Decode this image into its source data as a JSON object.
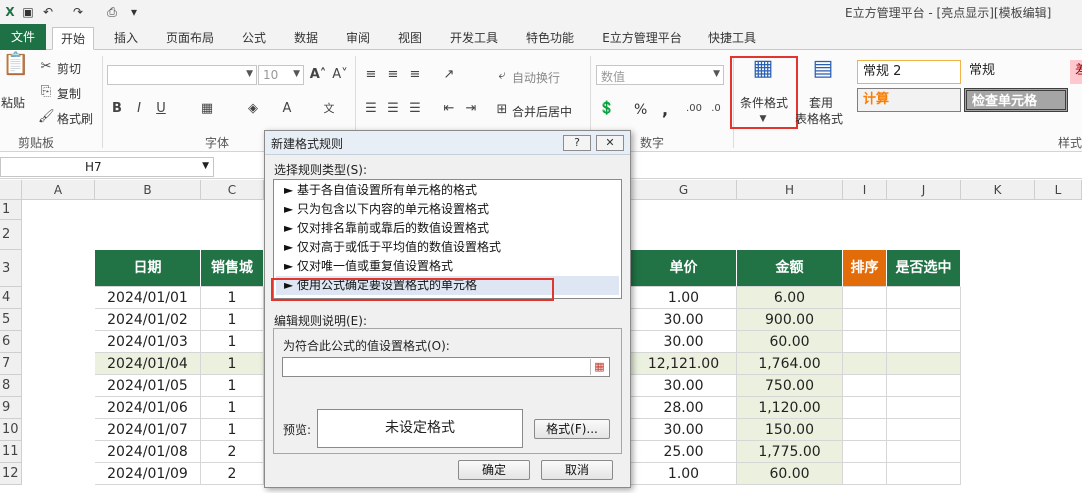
{
  "title_bar": {
    "text": "E立方管理平台 - [亮点显示][模板编辑]"
  },
  "tabs": [
    "文件",
    "开始",
    "插入",
    "页面布局",
    "公式",
    "数据",
    "审阅",
    "视图",
    "开发工具",
    "特色功能",
    "E立方管理平台",
    "快捷工具"
  ],
  "ribbon": {
    "clipboard": {
      "paste": "粘贴",
      "cut": "剪切",
      "copy": "复制",
      "format_painter": "格式刷",
      "label": "剪贴板"
    },
    "font": {
      "size": "10",
      "label": "字体"
    },
    "alignment": {
      "wrap": "自动换行",
      "merge": "合并后居中"
    },
    "number": {
      "format": "数值",
      "label": "数字",
      "percent": "%",
      "comma": ","
    },
    "cond_format": "条件格式",
    "table_format": [
      "套用",
      "表格格式"
    ],
    "styles": {
      "s1": "常规 2",
      "s2": "常规",
      "s3": "计算",
      "s4": "检查单元格",
      "label": "样式"
    }
  },
  "name_box": "H7",
  "columns": [
    "A",
    "B",
    "C",
    "G",
    "H",
    "I",
    "J",
    "K",
    "L"
  ],
  "rows": [
    "1",
    "2",
    "3",
    "4",
    "5",
    "6",
    "7",
    "8",
    "9",
    "10",
    "11",
    "12"
  ],
  "table": {
    "headers": {
      "date": "日期",
      "sales": "销售城",
      "price": "单价",
      "amount": "金额",
      "rank": "排序",
      "selected": "是否选中"
    },
    "dates": [
      "2024/01/01",
      "2024/01/02",
      "2024/01/03",
      "2024/01/04",
      "2024/01/05",
      "2024/01/06",
      "2024/01/07",
      "2024/01/08",
      "2024/01/09"
    ],
    "qty": [
      "1",
      "1",
      "1",
      "1",
      "1",
      "1",
      "1",
      "2",
      "2"
    ],
    "prices": [
      "1.00",
      "30.00",
      "30.00",
      "12,121.00",
      "30.00",
      "28.00",
      "30.00",
      "25.00",
      "1.00"
    ],
    "amounts": [
      "6.00",
      "900.00",
      "60.00",
      "1,764.00",
      "750.00",
      "1,120.00",
      "150.00",
      "1,775.00",
      "60.00"
    ]
  },
  "dialog": {
    "title": "新建格式规则",
    "help": "?",
    "close": "✕",
    "select_type_label": "选择规则类型(S):",
    "rule_types": [
      "► 基于各自值设置所有单元格的格式",
      "► 只为包含以下内容的单元格设置格式",
      "► 仅对排名靠前或靠后的数值设置格式",
      "► 仅对高于或低于平均值的数值设置格式",
      "► 仅对唯一值或重复值设置格式",
      "► 使用公式确定要设置格式的单元格"
    ],
    "edit_desc_label": "编辑规则说明(E):",
    "formula_label": "为符合此公式的值设置格式(O):",
    "preview_label": "预览:",
    "preview_text": "未设定格式",
    "format_button": "格式(F)...",
    "ok": "确定",
    "cancel": "取消"
  },
  "colors": {
    "header_green": "#217346",
    "header_orange": "#e26b0a",
    "highlight_red": "#e0362e"
  }
}
